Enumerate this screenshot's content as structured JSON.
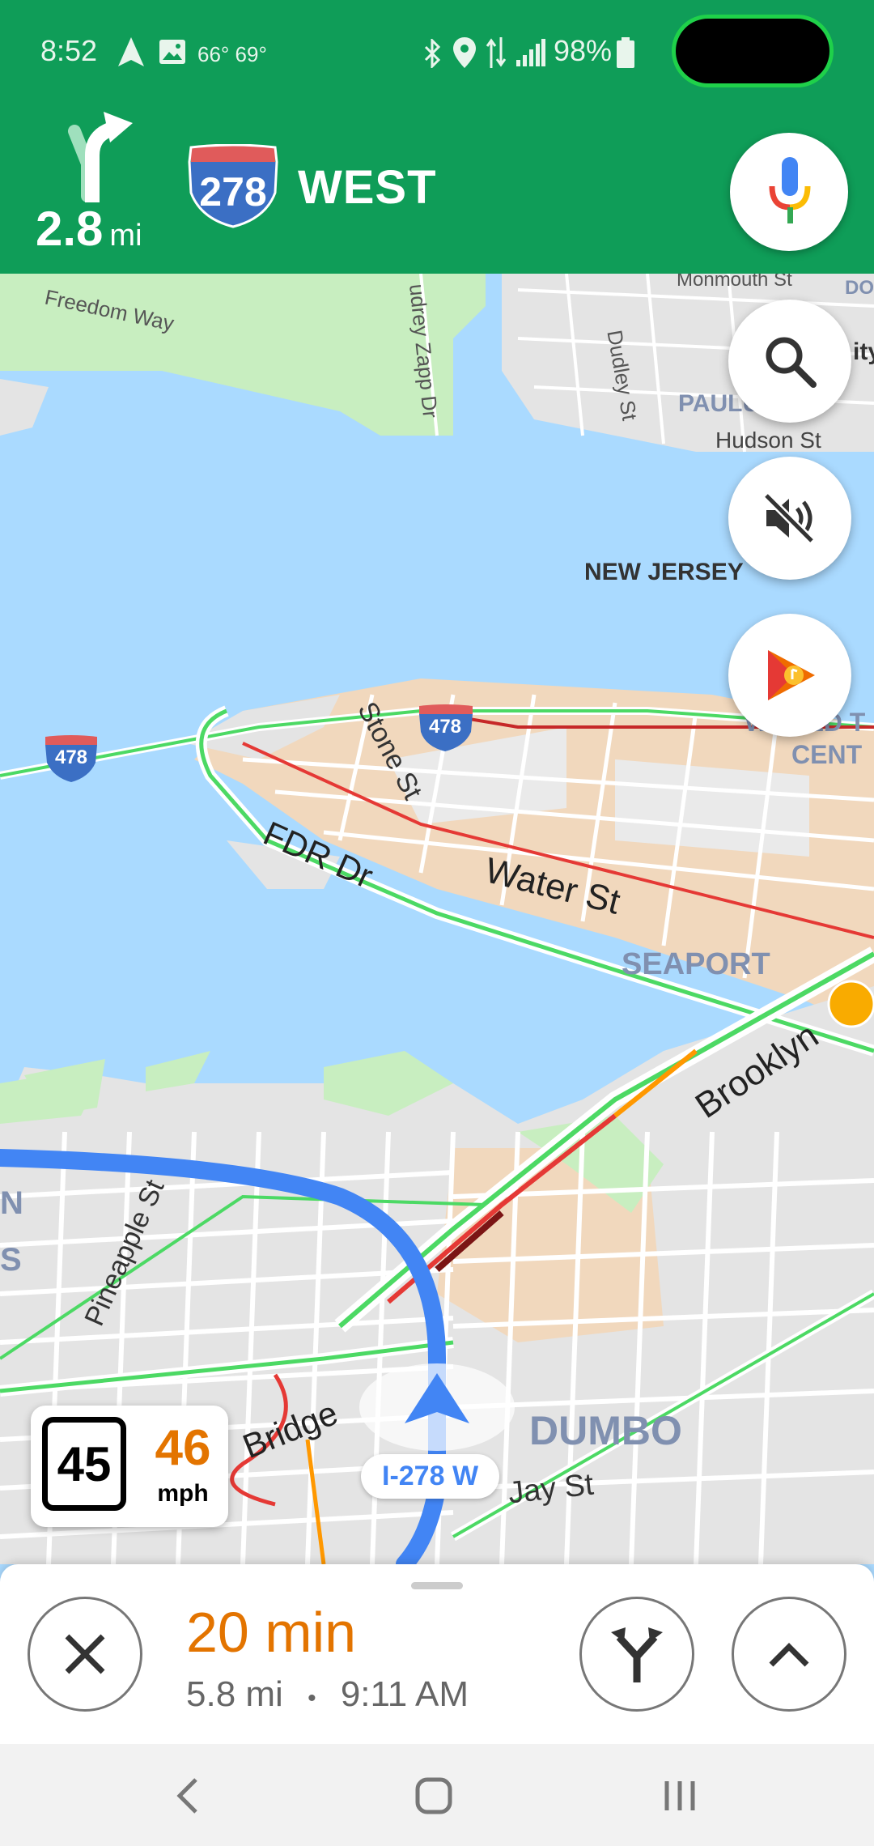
{
  "status_bar": {
    "time": "8:52",
    "temps": "66° 69°",
    "battery": "98%"
  },
  "nav_banner": {
    "distance_value": "2.8",
    "distance_unit": "mi",
    "shield_number": "278",
    "direction": "WEST"
  },
  "map": {
    "labels": {
      "freedom_way": "Freedom Way",
      "zapp_dr": "udrey Zapp Dr",
      "monmouth_st": "Monmouth St",
      "do": "DO",
      "ity": "ity",
      "dudley_st": "Dudley St",
      "paulus": "PAULU",
      "hudson_st": "Hudson St",
      "new_jersey": "NEW JERSEY",
      "world_trade_1": "WORLD T",
      "world_trade_2": "CENT",
      "stone_st": "Stone St",
      "fdr_dr": "FDR Dr",
      "water_st": "Water St",
      "seaport": "SEAPORT",
      "brooklyn": "Brooklyn",
      "pineapple_st": "Pineapple St",
      "n_label": "N",
      "s_label": "S",
      "bridge": "Bridge",
      "dumbo": "DUMBO",
      "jay_st": "Jay St"
    },
    "shields": [
      "478",
      "478"
    ],
    "current_road": "I-278 W"
  },
  "speed": {
    "limit": "45",
    "current": "46",
    "unit": "mph"
  },
  "bottom_sheet": {
    "eta_duration": "20 min",
    "distance": "5.8 mi",
    "separator": "•",
    "arrival_time": "9:11 AM"
  },
  "colors": {
    "nav_green": "#0f9d58",
    "water": "#aadaff",
    "route_blue": "#4285f4",
    "eta_orange": "#e37400"
  }
}
